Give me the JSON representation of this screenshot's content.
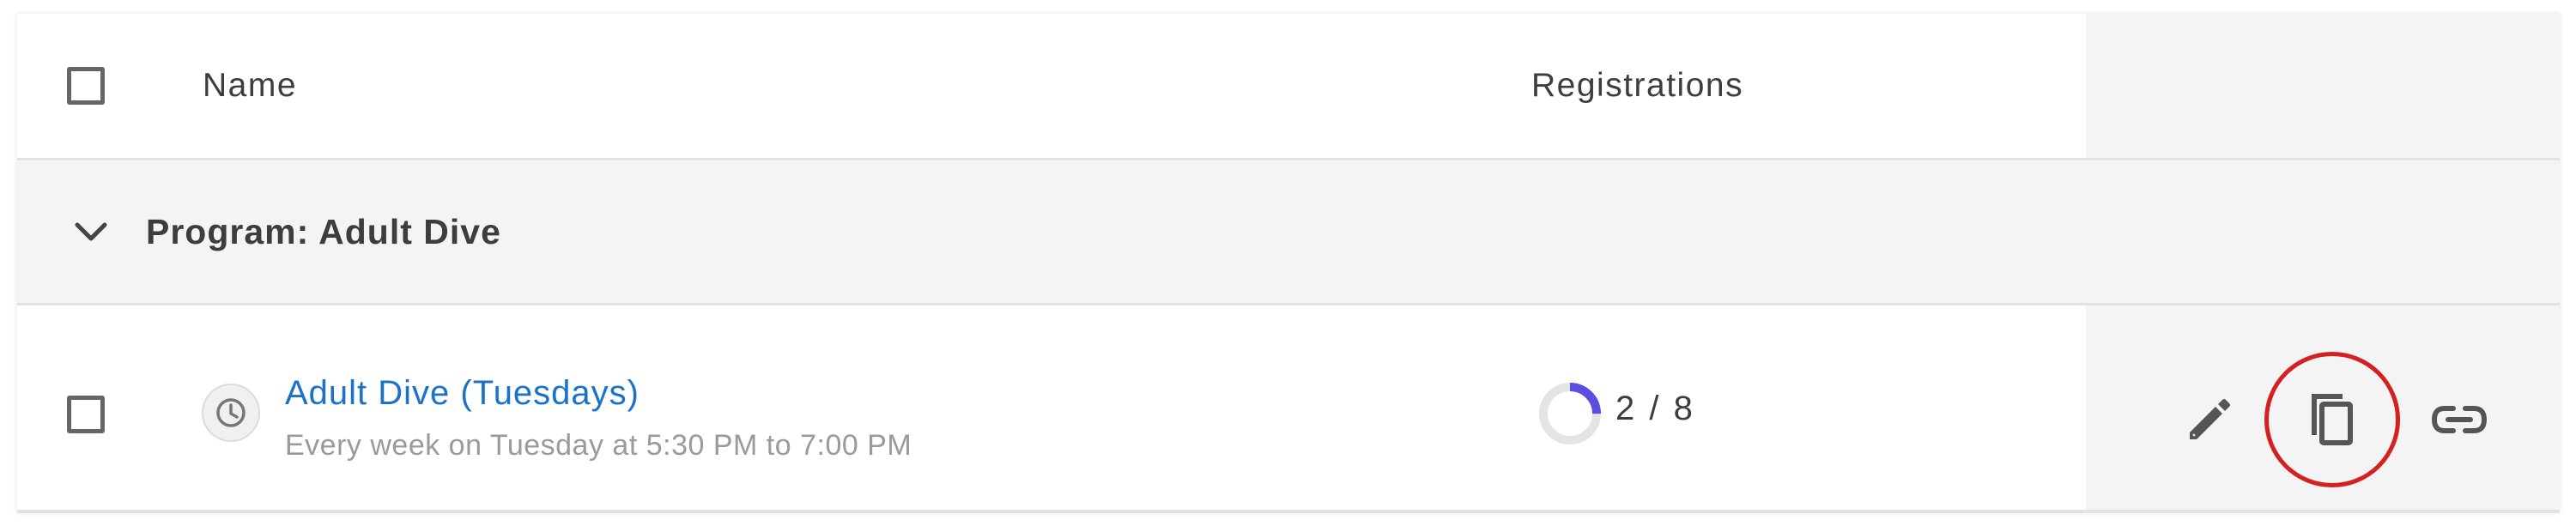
{
  "table": {
    "header": {
      "name_label": "Name",
      "registrations_label": "Registrations"
    },
    "group": {
      "title": "Program: Adult Dive",
      "expanded": true
    },
    "rows": [
      {
        "title": "Adult Dive (Tuesdays)",
        "schedule": "Every week on Tuesday at 5:30 PM to 7:00 PM",
        "registrations_text": "2 / 8",
        "registered": 2,
        "capacity": 8,
        "icon": "clock-icon",
        "actions": [
          "edit-icon",
          "copy-icon",
          "link-icon"
        ],
        "highlighted_action": "copy-icon"
      }
    ]
  },
  "colors": {
    "link": "#1a73c8",
    "progress": "#5b4fe0",
    "progress_track": "#e4e4e4",
    "highlight": "#d42020",
    "action_column_bg": "#f4f4f4"
  }
}
